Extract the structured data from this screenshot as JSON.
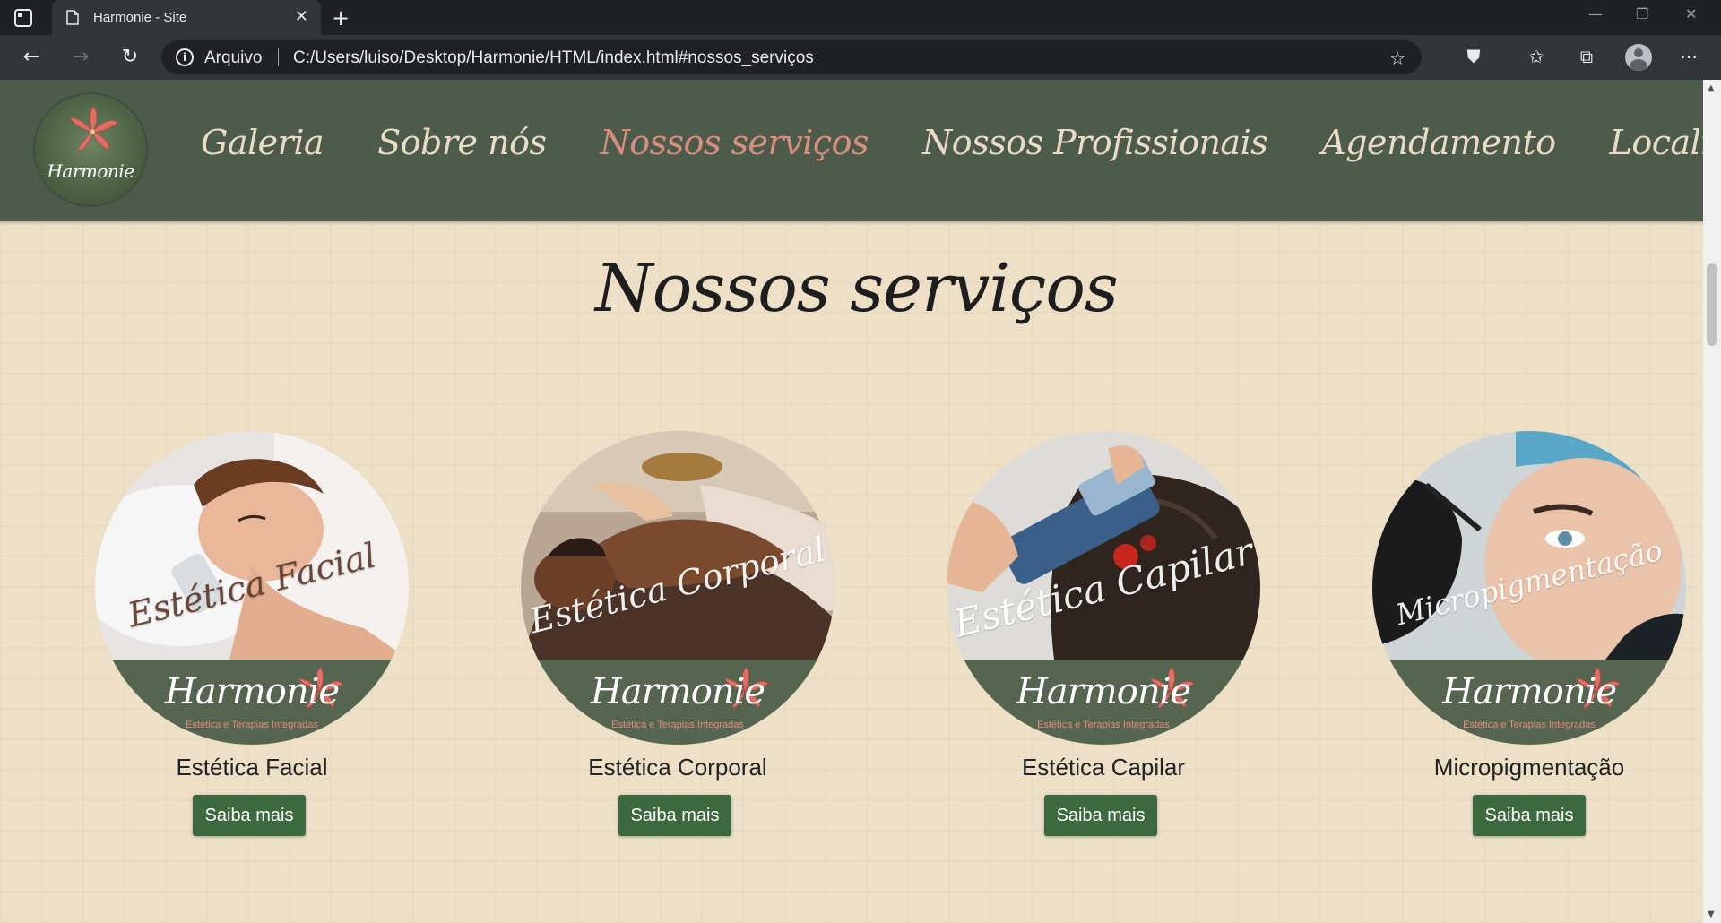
{
  "browser": {
    "tab_title": "Harmonie - Site",
    "address_label": "Arquivo",
    "url": "C:/Users/luiso/Desktop/Harmonie/HTML/index.html#nossos_serviços"
  },
  "site": {
    "logo_text": "Harmonie",
    "nav": [
      {
        "label": "Galeria",
        "active": false
      },
      {
        "label": "Sobre nós",
        "active": false
      },
      {
        "label": "Nossos serviços",
        "active": true
      },
      {
        "label": "Nossos Profissionais",
        "active": false
      },
      {
        "label": "Agendamento",
        "active": false
      },
      {
        "label": "Localização",
        "active": false
      }
    ],
    "colors": {
      "header_bg": "#4c5b4a",
      "nav_text": "#e9dcc7",
      "nav_active": "#d98f80",
      "page_bg": "#ede0c7",
      "button_bg": "#3c6a3e"
    }
  },
  "services": {
    "title": "Nossos serviços",
    "brand": "Harmonie",
    "brand_subtitle": "Estética e Terapias Integradas",
    "items": [
      {
        "overlay": "Estética Facial",
        "label": "Estética Facial",
        "button": "Saiba mais"
      },
      {
        "overlay": "Estética Corporal",
        "label": "Estética Corporal",
        "button": "Saiba mais"
      },
      {
        "overlay": "Estética Capilar",
        "label": "Estética Capilar",
        "button": "Saiba mais"
      },
      {
        "overlay": "Micropigmentação",
        "label": "Micropigmentação",
        "button": "Saiba mais"
      }
    ]
  }
}
